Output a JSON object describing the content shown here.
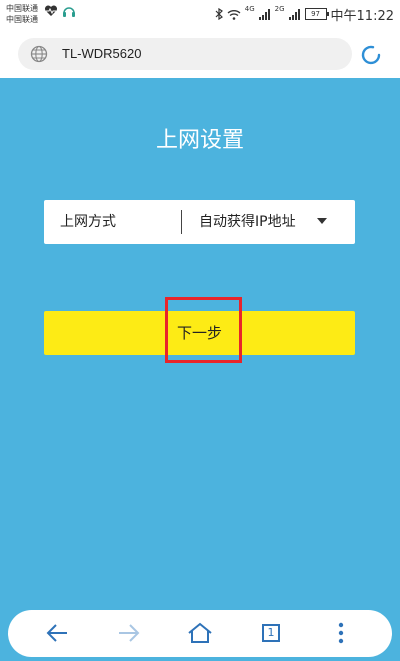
{
  "status_bar": {
    "carrier_line1": "中国联通",
    "carrier_line2": "中国联通",
    "sim1_badge": "4G",
    "sim2_badge": "2G",
    "battery_level": "97",
    "time": "中午11:22"
  },
  "address_bar": {
    "url": "TL-WDR5620",
    "globe_icon": "globe-icon",
    "refresh_icon": "refresh-icon"
  },
  "page": {
    "title": "上网设置",
    "connection_type": {
      "label": "上网方式",
      "value": "自动获得IP地址"
    },
    "next_button": "下一步"
  },
  "toolbar": {
    "back_icon": "back-arrow-icon",
    "forward_icon": "forward-arrow-icon",
    "home_icon": "home-icon",
    "tab_count": "1",
    "menu_icon": "more-vertical-icon"
  },
  "colors": {
    "page_background": "#4cb3de",
    "button_background": "#fdeb15",
    "highlight": "#e8252a",
    "nav_icon": "#2e72b8"
  }
}
